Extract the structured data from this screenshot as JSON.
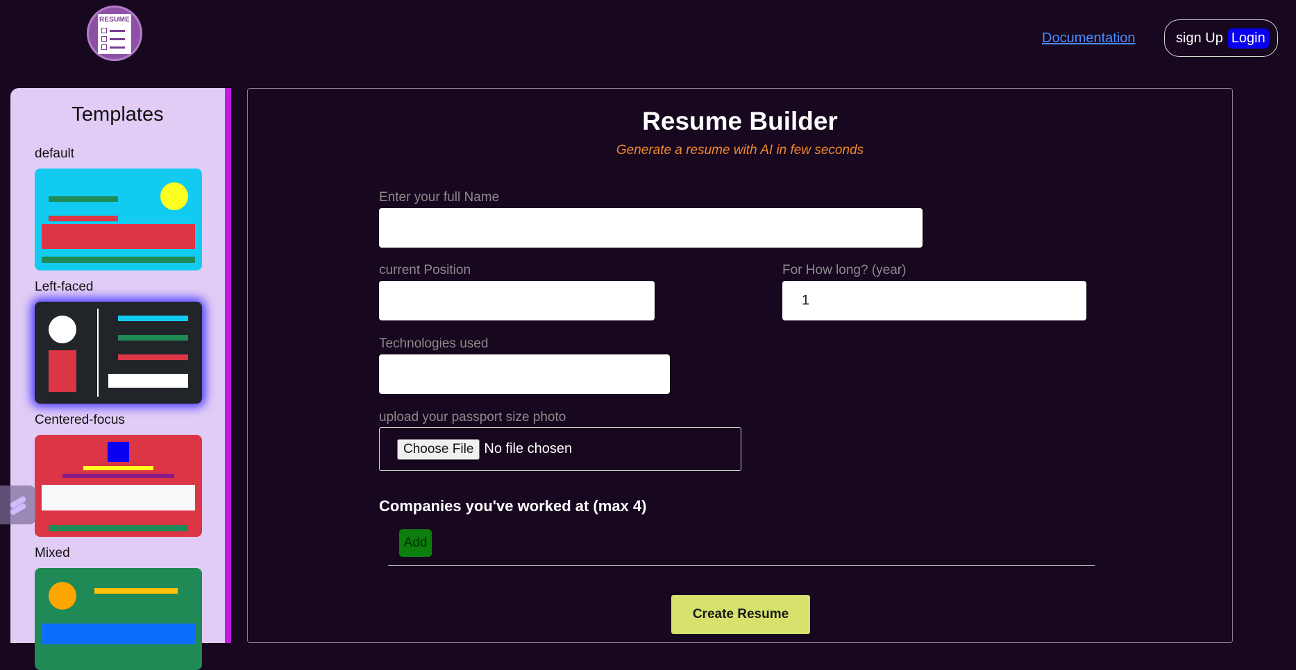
{
  "header": {
    "logo_text": "RESUME",
    "documentation_link": "Documentation",
    "signup_label": "sign Up",
    "login_label": "Login"
  },
  "sidebar": {
    "title": "Templates",
    "templates": [
      {
        "label": "default"
      },
      {
        "label": "Left-faced"
      },
      {
        "label": "Centered-focus"
      },
      {
        "label": "Mixed"
      }
    ]
  },
  "main": {
    "title": "Resume Builder",
    "subtitle": "Generate a resume with AI in few seconds",
    "fields": {
      "full_name": {
        "label": "Enter your full Name",
        "value": ""
      },
      "position": {
        "label": "current Position",
        "value": ""
      },
      "years": {
        "label": "For How long? (year)",
        "value": "1"
      },
      "technologies": {
        "label": "Technologies used",
        "value": ""
      },
      "photo": {
        "label": "upload your passport size photo",
        "button": "Choose File",
        "status": "No file chosen"
      }
    },
    "companies_heading": "Companies you've worked at (max 4)",
    "add_button": "Add",
    "create_button": "Create Resume"
  },
  "colors": {
    "background": "#17071f",
    "sidebar_bg": "#e0ccf5",
    "sidebar_border": "#c31ae0",
    "subtitle": "#f0872c",
    "login_bg": "#0a00f0",
    "add_bg": "#0d7d0d",
    "create_bg": "#d6e26c",
    "link": "#4c8dff"
  }
}
